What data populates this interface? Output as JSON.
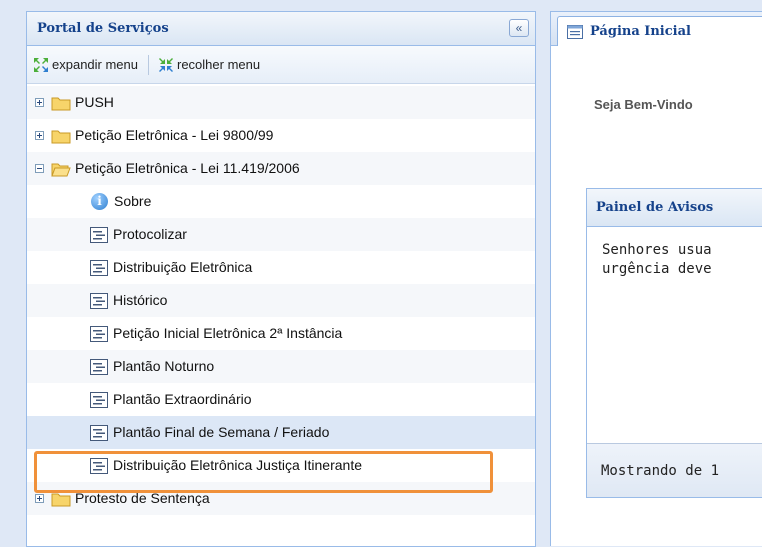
{
  "left_panel": {
    "title": "Portal de Serviços",
    "collapse_glyph": "«",
    "toolbar": {
      "expand_label": "expandir menu",
      "collapse_label": "recolher menu"
    },
    "tree": [
      {
        "label": "PUSH",
        "type": "folder",
        "expander": "plus"
      },
      {
        "label": "Petição Eletrônica - Lei 9800/99",
        "type": "folder",
        "expander": "plus"
      },
      {
        "label": "Petição Eletrônica - Lei 11.419/2006",
        "type": "folder-open",
        "expander": "minus"
      },
      {
        "label": "Sobre",
        "type": "info"
      },
      {
        "label": "Protocolizar",
        "type": "doc"
      },
      {
        "label": "Distribuição Eletrônica",
        "type": "doc"
      },
      {
        "label": "Histórico",
        "type": "doc"
      },
      {
        "label": "Petição Inicial Eletrônica 2ª Instância",
        "type": "doc"
      },
      {
        "label": "Plantão Noturno",
        "type": "doc"
      },
      {
        "label": "Plantão Extraordinário",
        "type": "doc"
      },
      {
        "label": "Plantão Final de Semana / Feriado",
        "type": "doc",
        "selected": true
      },
      {
        "label": "Distribuição Eletrônica Justiça Itinerante",
        "type": "doc"
      },
      {
        "label": "Protesto de Sentença",
        "type": "folder",
        "expander": "plus"
      }
    ]
  },
  "right_panel": {
    "tab_label": "Página Inicial",
    "welcome_text": "Seja Bem-Vindo",
    "notice": {
      "title": "Painel de Avisos",
      "body_line1": "Senhores usua",
      "body_line2": "urgência deve",
      "footer_text": "Mostrando de 1"
    }
  },
  "colors": {
    "panel_border": "#99bbe8",
    "header_text": "#15428b",
    "selection_bg": "#dce7f6",
    "highlight_border": "#f0913a"
  },
  "icons": {
    "collapse": "double-chevron-left-icon",
    "expand_menu": "expand-arrows-icon",
    "collapse_menu": "collapse-arrows-icon",
    "folder": "folder-icon",
    "leaf": "document-icon",
    "info": "info-icon",
    "tab": "page-icon"
  }
}
